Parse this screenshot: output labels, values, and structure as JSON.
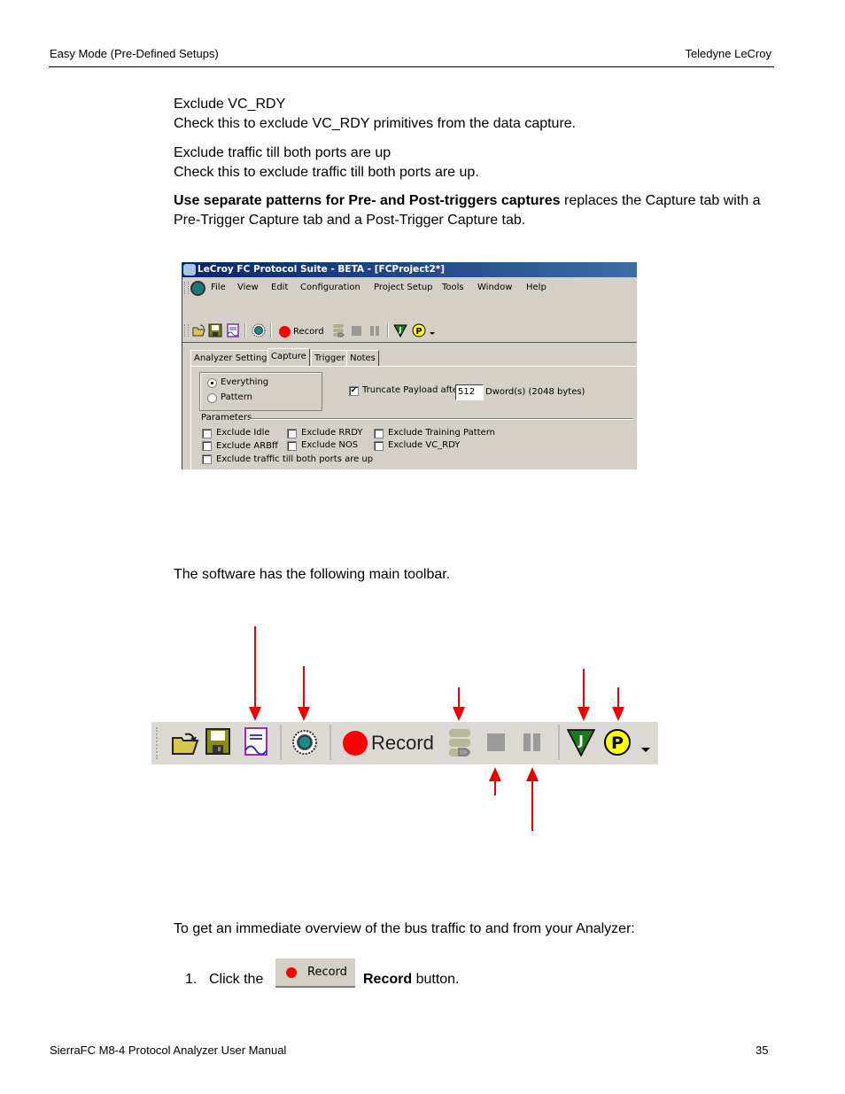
{
  "header": {
    "section": "Easy Mode (Pre-Defined Setups)",
    "company": "Teledyne  LeCroy"
  },
  "content": {
    "p1_title": "Exclude VC_RDY",
    "p1_text": "Check this to exclude VC_RDY primitives from the data capture.",
    "p2_title": "Exclude traffic till both ports are up",
    "p2_text": "Check this to exclude traffic till both ports are up.",
    "p3_bold": "Use separate patterns for Pre- and Post-triggers captures",
    "p3_rest_line1": " replaces the Capture tab with a",
    "p3_line2": "Pre-Trigger Capture tab and a Post-Trigger Capture tab.",
    "toolbar_intro": "The software has the following main toolbar.",
    "overview_intro": "To get an immediate overview of the bus traffic to and from your Analyzer:",
    "step1_number": "1.",
    "step1_prefix": "Click the",
    "step1_bold": "Record",
    "step1_suffix": " button."
  },
  "screenshot": {
    "title": "LeCroy FC Protocol Suite - BETA - [FCProject2*]",
    "menu": [
      "File",
      "View",
      "Edit",
      "Configuration",
      "Project Setup",
      "Tools",
      "Window",
      "Help"
    ],
    "toolbar": {
      "record_label": "Record",
      "icons": [
        "open-folder-icon",
        "save-icon",
        "report-icon",
        "analyzer-chip-icon",
        "record-icon",
        "traffic-generator-icon",
        "stop-icon",
        "pause-icon",
        "trigger-j-icon",
        "pattern-p-icon",
        "dropdown-arrow-icon"
      ]
    },
    "tabs": [
      "Analyzer Settings",
      "Capture",
      "Trigger",
      "Notes"
    ],
    "active_tab": "Capture",
    "capture_mode": {
      "options": [
        "Everything",
        "Pattern"
      ],
      "selected": "Everything"
    },
    "truncate": {
      "label": "Truncate Payload after",
      "checked": true,
      "value": "512",
      "unit": "Dword(s)  (2048 bytes)"
    },
    "parameters": {
      "group_label": "Parameters",
      "items": [
        {
          "label": "Exclude Idle",
          "checked": false
        },
        {
          "label": "Exclude RRDY",
          "checked": false
        },
        {
          "label": "Exclude Training Pattern",
          "checked": false
        },
        {
          "label": "Exclude ARBff",
          "checked": false
        },
        {
          "label": "Exclude NOS",
          "checked": false
        },
        {
          "label": "Exclude VC_RDY",
          "checked": false
        },
        {
          "label": "Exclude traffic till both ports are up",
          "checked": false
        }
      ]
    }
  },
  "main_toolbar": {
    "record_label": "Record"
  },
  "record_button": {
    "label": "Record"
  },
  "footer": {
    "manual": "SierraFC M8-4 Protocol Analyzer User Manual",
    "page": "35"
  },
  "colors": {
    "title_bar_start": "#0a246a",
    "title_bar_end": "#3a6ea5",
    "window_bg": "#d4d0c8",
    "record_red": "#ff0000",
    "arrow_red": "#e00000",
    "trigger_green": "#1a7a1a",
    "pattern_yellow": "#ffff00"
  }
}
